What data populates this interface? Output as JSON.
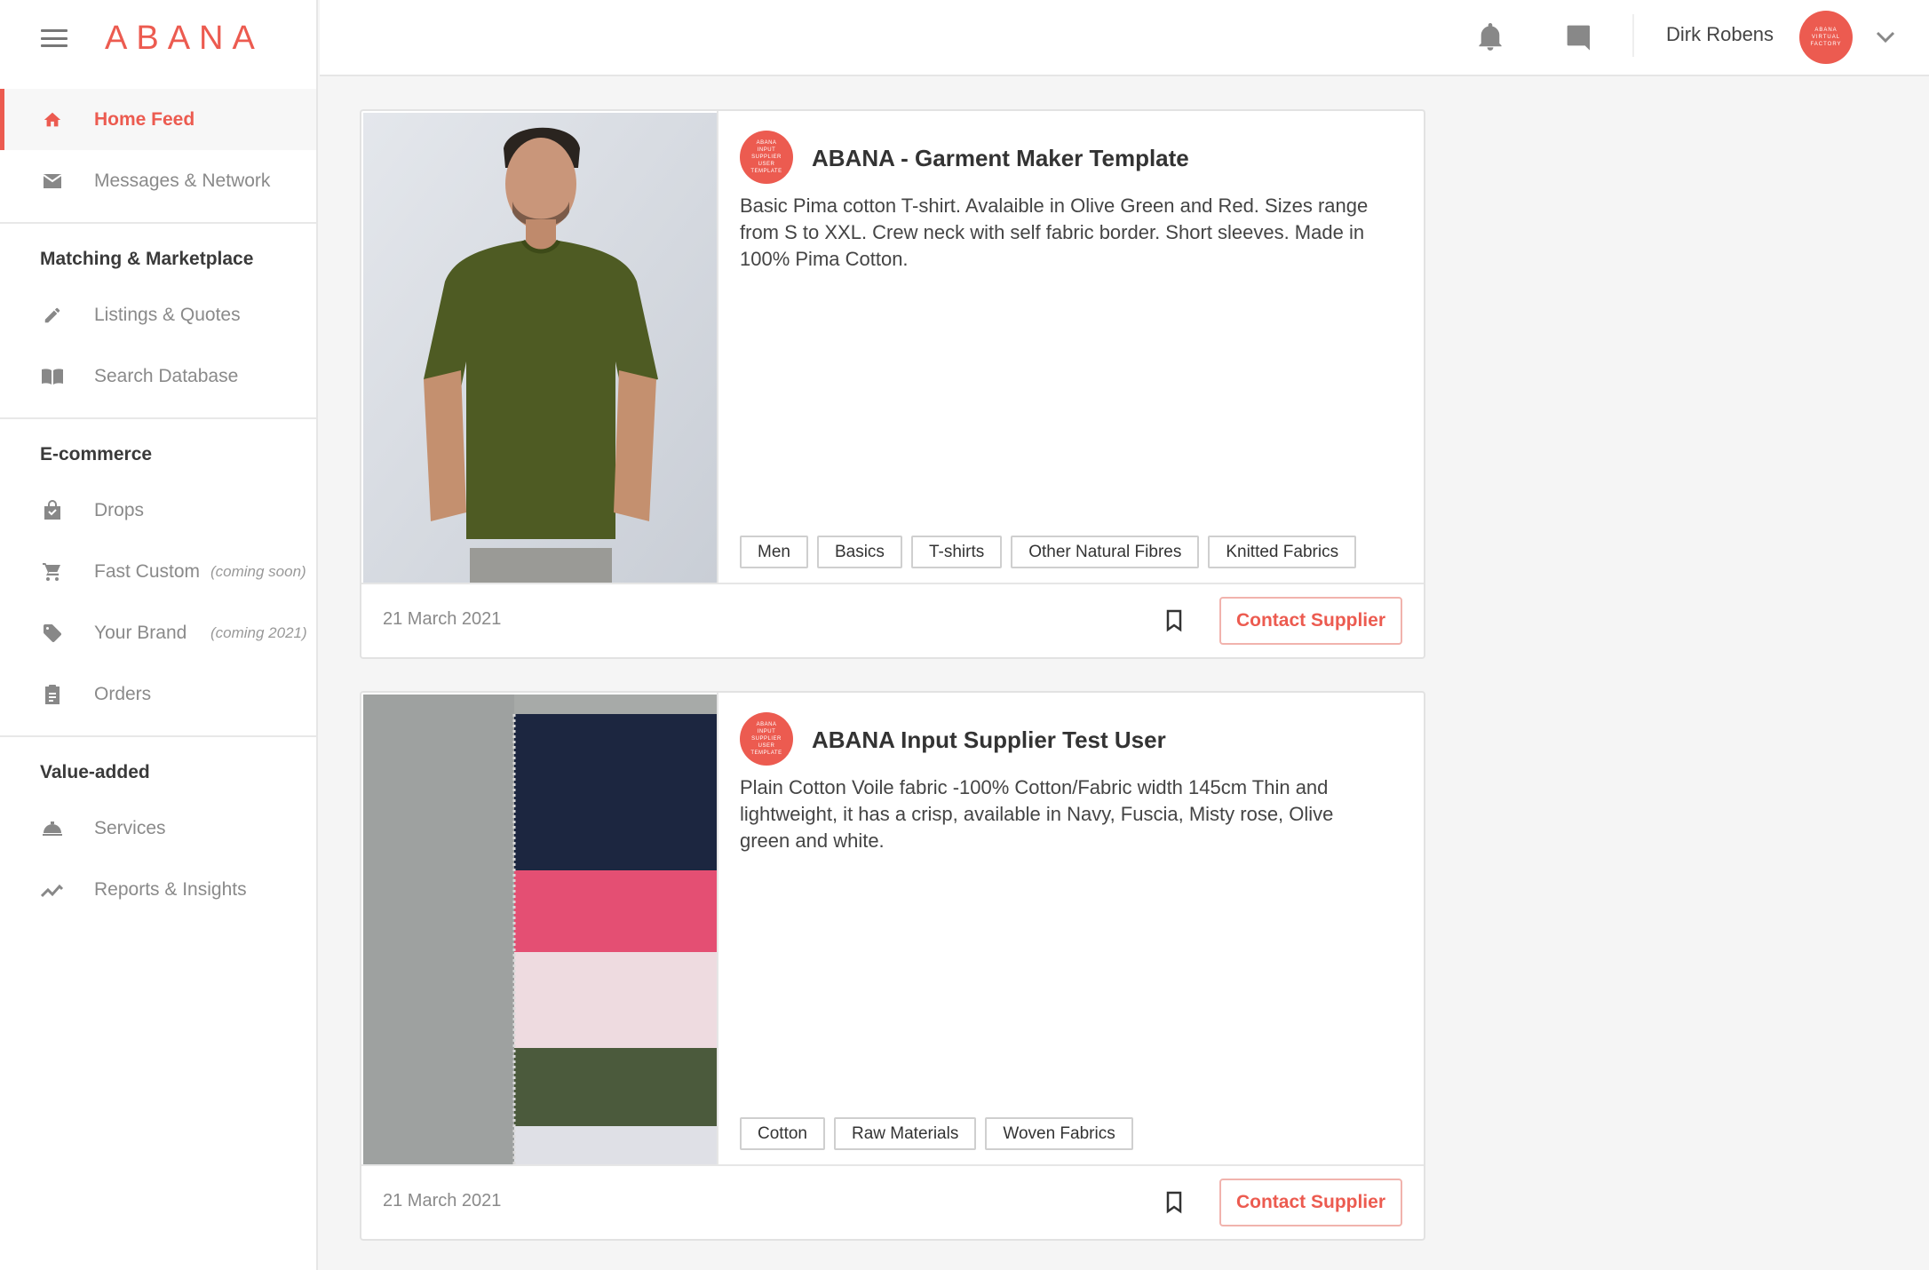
{
  "brand": {
    "logo_text": "ABANA"
  },
  "sidebar": {
    "top_items": [
      {
        "label": "Home Feed",
        "icon": "home-icon",
        "active": true
      },
      {
        "label": "Messages & Network",
        "icon": "mail-icon"
      }
    ],
    "sections": [
      {
        "title": "Matching & Marketplace",
        "items": [
          {
            "label": "Listings & Quotes",
            "icon": "pencil-icon"
          },
          {
            "label": "Search Database",
            "icon": "book-icon"
          }
        ]
      },
      {
        "title": "E-commerce",
        "items": [
          {
            "label": "Drops",
            "icon": "shopping-bag-icon"
          },
          {
            "label": "Fast Custom",
            "icon": "cart-icon",
            "note": "(coming soon)"
          },
          {
            "label": "Your Brand",
            "icon": "tag-icon",
            "note": "(coming 2021)"
          },
          {
            "label": "Orders",
            "icon": "clipboard-icon"
          }
        ]
      },
      {
        "title": "Value-added",
        "items": [
          {
            "label": "Services",
            "icon": "service-bell-icon"
          },
          {
            "label": "Reports & Insights",
            "icon": "trending-icon"
          }
        ]
      }
    ]
  },
  "topbar": {
    "user_name": "Dirk Robens",
    "avatar_lines": [
      "ABANA",
      "VIRTUAL",
      "FACTORY"
    ]
  },
  "feed": {
    "cards": [
      {
        "supplier_name": "ABANA - Garment Maker Template",
        "logo_lines": [
          "ABANA",
          "INPUT",
          "SUPPLIER",
          "USER",
          "TEMPLATE"
        ],
        "description": "Basic Pima cotton T-shirt. Avalaible in Olive Green and Red. Sizes range from S to XXL. Crew neck with self fabric border. Short sleeves. Made in 100% Pima Cotton.",
        "tags": [
          "Men",
          "Basics",
          "T-shirts",
          "Other Natural Fibres",
          "Knitted Fabrics"
        ],
        "date": "21 March 2021",
        "contact_label": "Contact Supplier"
      },
      {
        "supplier_name": "ABANA Input Supplier Test User",
        "logo_lines": [
          "ABANA",
          "INPUT",
          "SUPPLIER",
          "USER",
          "TEMPLATE"
        ],
        "description": "Plain Cotton Voile fabric -100% Cotton/Fabric width 145cm Thin and lightweight, it has a crisp,  available in Navy, Fuscia, Misty rose, Olive green and white.",
        "tags": [
          "Cotton",
          "Raw Materials",
          "Woven Fabrics"
        ],
        "date": "21 March 2021",
        "contact_label": "Contact Supplier"
      }
    ]
  },
  "colors": {
    "accent": "#ec5b50",
    "sidebar_text": "#8a8a8a"
  }
}
